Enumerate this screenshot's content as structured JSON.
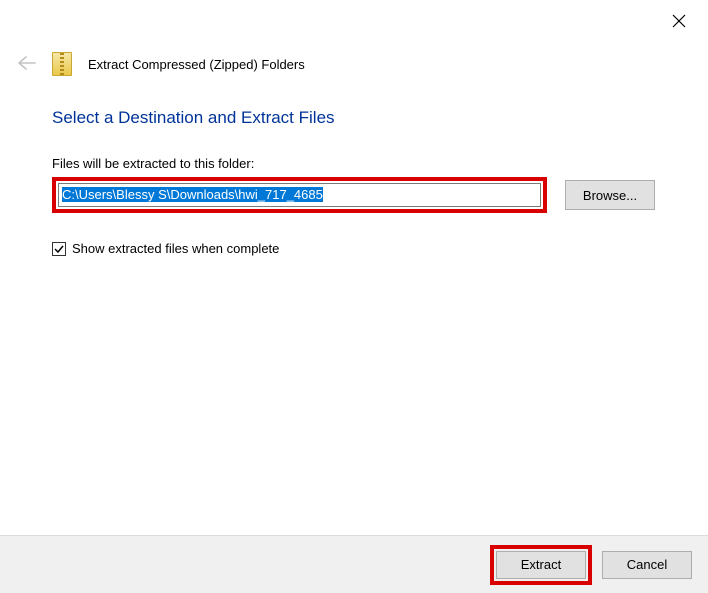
{
  "window": {
    "title": "Extract Compressed (Zipped) Folders"
  },
  "main": {
    "heading": "Select a Destination and Extract Files",
    "field_label": "Files will be extracted to this folder:",
    "path_value": "C:\\Users\\Blessy S\\Downloads\\hwi_717_4685",
    "browse_label": "Browse...",
    "show_files_label": "Show extracted files when complete",
    "show_files_checked": true
  },
  "footer": {
    "extract_label": "Extract",
    "cancel_label": "Cancel"
  }
}
